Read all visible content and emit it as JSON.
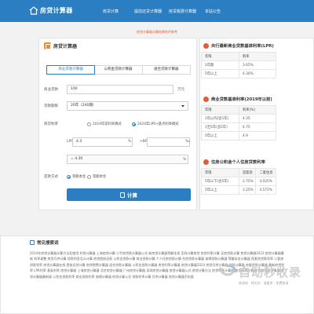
{
  "header": {
    "site_title": "房贷计算器",
    "nav": [
      "房贷计算",
      "提前还贷计算器",
      "房贷税费计算器",
      "本站公告"
    ]
  },
  "notice": "房贷计算器计算结果仅供参考",
  "calculator": {
    "title": "房贷计算器",
    "tabs": [
      "商业贷款计算器",
      "公积金贷款计算器",
      "组合贷款计算器"
    ],
    "active_tab": 0,
    "loan_amount_label": "商业贷款",
    "loan_amount_value": "100",
    "loan_amount_unit": "万元",
    "loan_term_label": "贷款期限",
    "loan_term_value": "20年（240期）",
    "rate_label": "商贷利率",
    "rate_modes": [
      "2019年前利率模式",
      "2024年LPR+基点利率模式"
    ],
    "rate_mode_selected": 1,
    "lpr_label": "LPR",
    "lpr_value": "4.3",
    "lpr_unit": "%",
    "bp_label": "+BP",
    "bp_value": "",
    "bp_unit": "‰",
    "result_rate_prefix": "=",
    "result_rate_value": "4.30",
    "result_rate_unit": "%",
    "repay_label": "还款方式",
    "repay_modes": [
      "等额本息",
      "等额本金"
    ],
    "repay_selected": 0,
    "calc_button": "计算"
  },
  "side": {
    "lpr": {
      "title": "央行最新商业贷款基准利率(LPR)",
      "header": [
        "年限",
        "利率"
      ],
      "rows": [
        [
          "1年期",
          "3.65%"
        ],
        [
          "5年以上",
          "4.30%"
        ]
      ]
    },
    "commercial": {
      "title": "商业贷款基准利率(2019年以前)",
      "header": [
        "年限",
        "利率(%)"
      ],
      "rows": [
        [
          "1年以内(含1年)",
          "4.35"
        ],
        [
          "1至5年(含5年)",
          "4.75"
        ],
        [
          "5年以上",
          "4.9"
        ]
      ]
    },
    "provident": {
      "title": "住房公积金个人住房贷款利率",
      "header": [
        "年限",
        "首套房",
        "二套住房"
      ],
      "rows": [
        [
          "5年以下(含5年)",
          "2.75%",
          "3.025%"
        ],
        [
          "5年以上",
          "3.25%",
          "3.575%"
        ]
      ]
    }
  },
  "hot": {
    "title": "常见搜索词",
    "text": "2014年房贷计算器计算方法及使用 利贷计算器 上海房贷计算 二手房贷款计算器公式 新房贷计算器等额本息 怎样计算房贷 房贷利率计算 买房贷款计算 房贷计算器2023 房贷计算器最新 利率调整 房贷月供计算 贷款利息怎么计算 房贷提前还款 公积金贷款计算 商业贷款计算 个人住房贷款计算 住房贷款计算器 按揭贷款计算器 等额本金计算器 首套房贷款利率 二套房贷款利率 房贷计算器在线 提前还贷计算 房贷税费计算器 组合贷款计算器 公积金贷款计算器 房贷利率计算器 房贷计算器2024 房贷月供计算器 贷款计算器 房屋贷款计算器 最新房贷利率 LPR利率 基准利率 房贷计算器 上海房贷计算器 北京房贷计算器 广州房贷计算器 深圳房贷计算器 房贷计算器公式 房贷计算方法 房贷利息计算器 房贷还款计算器 购房贷款计算器 房贷计算器最新版 公积金贷款利率 商业贷款利率 按揭计算器 房贷计算公式 贷款利率计算 月供计算器 房贷计算器手机版"
  },
  "watermark": {
    "brand": "自动秒收录",
    "slogan": "收录快 · 排名好 · 流量多 · 免费收录"
  },
  "colors": {
    "primary": "#2b7ec1",
    "accent": "#e45a3c",
    "orange": "#f28c28"
  }
}
